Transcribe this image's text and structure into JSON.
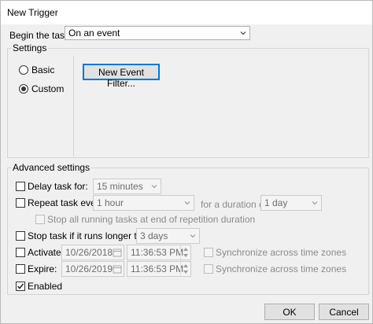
{
  "window": {
    "title": "New Trigger"
  },
  "begin_task": {
    "label": "Begin the task:",
    "value": "On an event"
  },
  "settings": {
    "title": "Settings",
    "basic_label": "Basic",
    "custom_label": "Custom",
    "selected": "Custom",
    "filter_button": "New Event Filter..."
  },
  "advanced": {
    "title": "Advanced settings",
    "delay": {
      "label": "Delay task for:",
      "checked": false,
      "value": "15 minutes"
    },
    "repeat": {
      "label": "Repeat task every:",
      "checked": false,
      "value": "1 hour",
      "duration_label": "for a duration of:",
      "duration_value": "1 day"
    },
    "stop_running": {
      "label": "Stop all running tasks at end of repetition duration",
      "checked": false
    },
    "stop_longer": {
      "label": "Stop task if it runs longer than:",
      "checked": false,
      "value": "3 days"
    },
    "activate": {
      "label": "Activate:",
      "checked": false,
      "date": "10/26/2018",
      "time": "11:36:53 PM",
      "sync_label": "Synchronize across time zones"
    },
    "expire": {
      "label": "Expire:",
      "checked": false,
      "date": "10/26/2019",
      "time": "11:36:53 PM",
      "sync_label": "Synchronize across time zones"
    },
    "enabled": {
      "label": "Enabled",
      "checked": true
    }
  },
  "buttons": {
    "ok": "OK",
    "cancel": "Cancel"
  },
  "icons": [
    "chevron-down-icon",
    "checkmark-icon",
    "calendar-icon",
    "spin-up-icon",
    "spin-down-icon"
  ]
}
